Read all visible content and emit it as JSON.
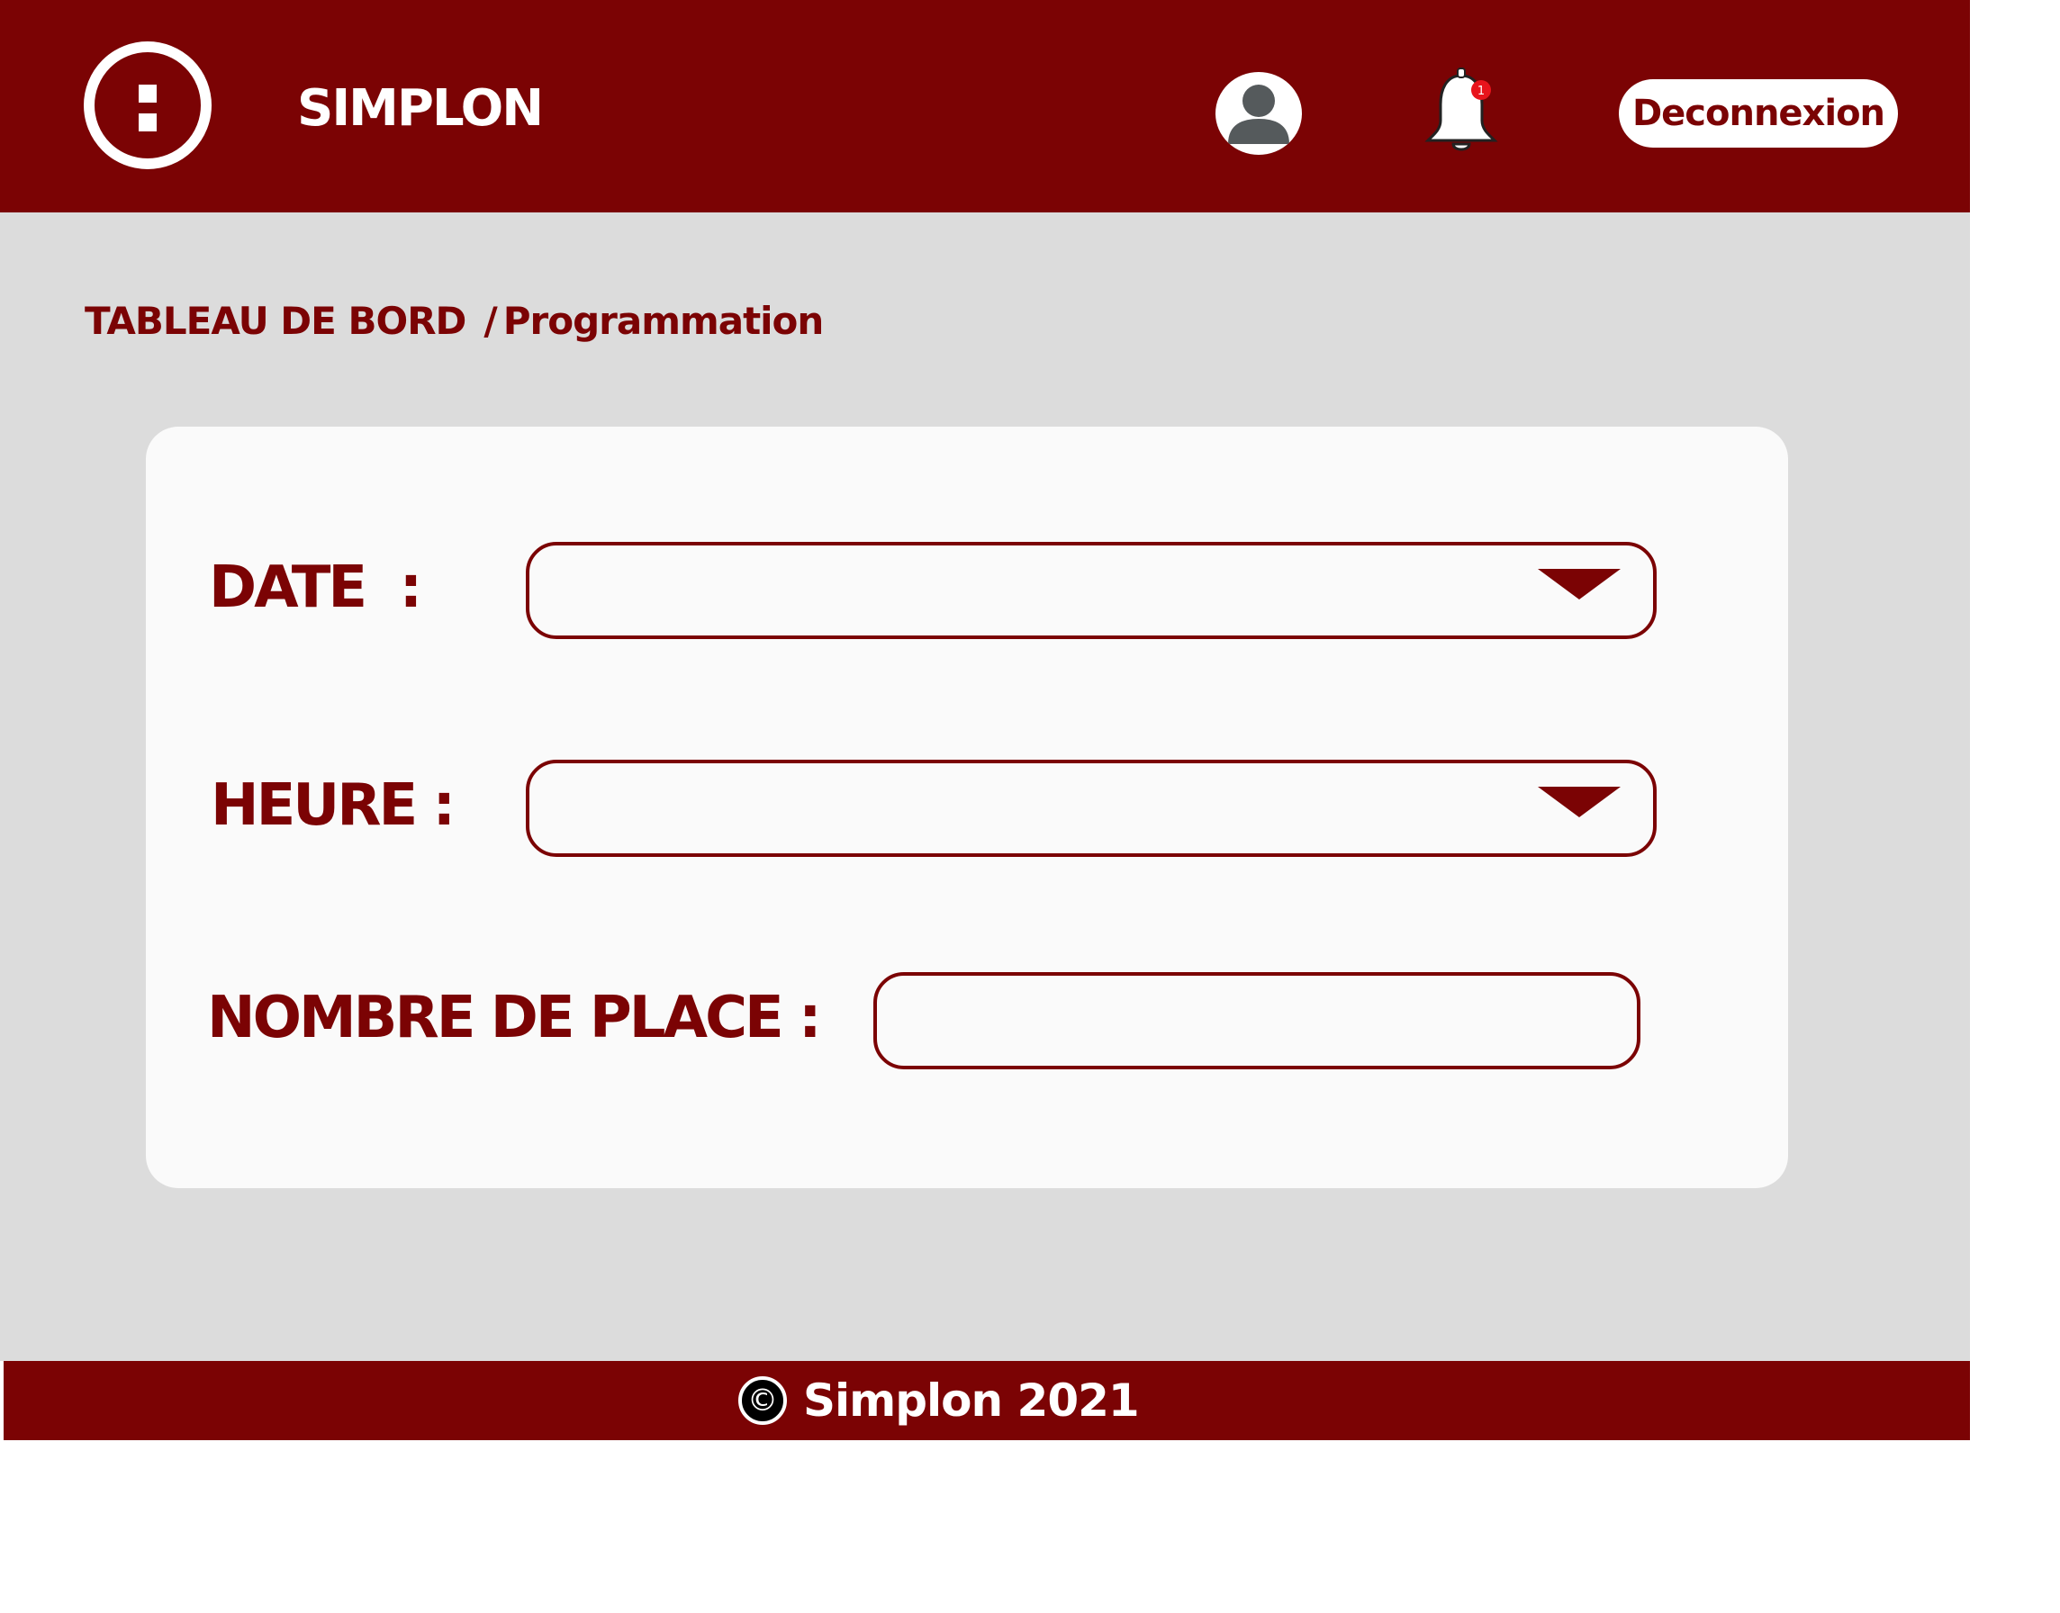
{
  "header": {
    "brand": "SIMPLON",
    "notification_count": "1",
    "logout_label": "Deconnexion"
  },
  "breadcrumb": {
    "root": "TABLEAU DE BORD",
    "separator": "/",
    "current": "Programmation"
  },
  "form": {
    "date_label": "DATE  :",
    "date_value": "",
    "heure_label": "HEURE :",
    "heure_value": "",
    "places_label": "NOMBRE DE PLACE :",
    "places_value": ""
  },
  "footer": {
    "copyright_symbol": "©",
    "text": "Simplon 2021"
  },
  "colors": {
    "brand": "#7b0304",
    "background": "#dcdcdc",
    "card": "#fafafa",
    "notification_badge": "#e8141c"
  }
}
